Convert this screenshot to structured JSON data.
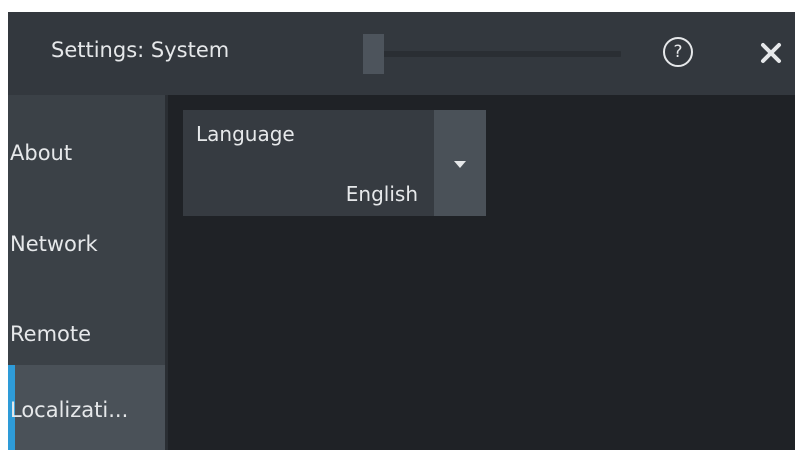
{
  "window": {
    "title": "Settings: System"
  },
  "title_bar": {
    "help_icon": "help-icon",
    "close_icon": "close-icon",
    "slider_level": 0.0
  },
  "sidebar": {
    "items": [
      {
        "label": "About",
        "active": false
      },
      {
        "label": "Network",
        "active": false
      },
      {
        "label": "Remote",
        "active": false
      },
      {
        "label": "Localizati...",
        "active": true
      }
    ]
  },
  "main": {
    "language": {
      "label": "Language",
      "value": "English",
      "dropdown_icon": "chevron-down-icon"
    }
  },
  "colors": {
    "accent": "#2e9bd8",
    "background": "#1f2226",
    "title_bar": "#33383e",
    "sidebar": "#3b4147",
    "sidebar_active": "#4a5158",
    "text": "#e6e8ea"
  }
}
